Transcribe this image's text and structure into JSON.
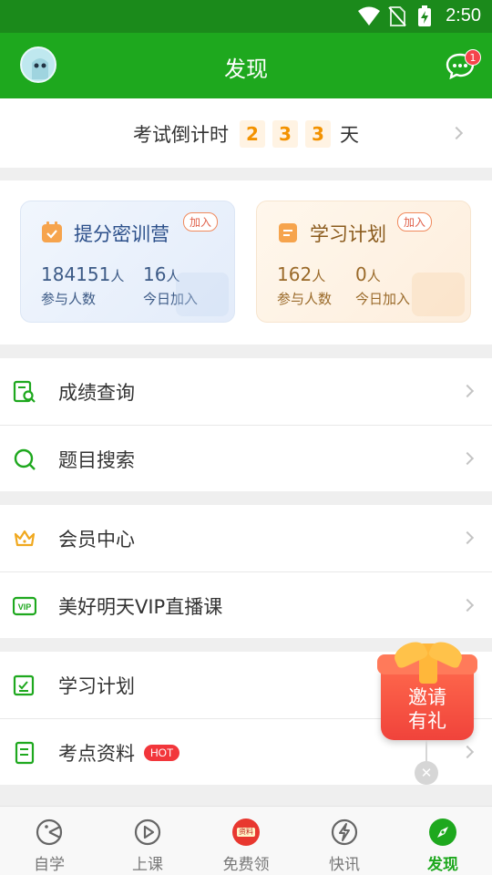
{
  "status_bar": {
    "time": "2:50"
  },
  "header": {
    "title": "发现",
    "message_badge": "1",
    "accent": "#1ea81e"
  },
  "countdown": {
    "prefix": "考试倒计时",
    "digits": [
      "2",
      "3",
      "3"
    ],
    "unit": "天"
  },
  "cards": [
    {
      "title": "提分密训营",
      "join": "加入",
      "stats": [
        {
          "value": "184151",
          "unit": "人",
          "label": "参与人数"
        },
        {
          "value": "16",
          "unit": "人",
          "label": "今日加入"
        }
      ]
    },
    {
      "title": "学习计划",
      "join": "加入",
      "stats": [
        {
          "value": "162",
          "unit": "人",
          "label": "参与人数"
        },
        {
          "value": "0",
          "unit": "人",
          "label": "今日加入"
        }
      ]
    }
  ],
  "menu": {
    "score_query": {
      "label": "成绩查询",
      "icon": "score-search-icon"
    },
    "question_search": {
      "label": "题目搜索",
      "icon": "search-icon"
    },
    "member_center": {
      "label": "会员中心",
      "icon": "crown-icon"
    },
    "vip_live": {
      "label": "美好明天VIP直播课",
      "icon": "vip-icon"
    },
    "study_plan": {
      "label": "学习计划",
      "icon": "edit-checklist-icon"
    },
    "exam_materials": {
      "label": "考点资料",
      "badge": "HOT",
      "icon": "document-icon"
    }
  },
  "floating_gift": {
    "line1": "邀请",
    "line2": "有礼",
    "close": "✕"
  },
  "tabbar": [
    {
      "label": "自学",
      "icon": "self-study-icon",
      "active": false
    },
    {
      "label": "上课",
      "icon": "play-icon",
      "active": false
    },
    {
      "label": "免费领",
      "icon": "materials-badge-icon",
      "badge": "资料",
      "active": false
    },
    {
      "label": "快讯",
      "icon": "lightning-icon",
      "active": false
    },
    {
      "label": "发现",
      "icon": "compass-icon",
      "active": true
    }
  ]
}
